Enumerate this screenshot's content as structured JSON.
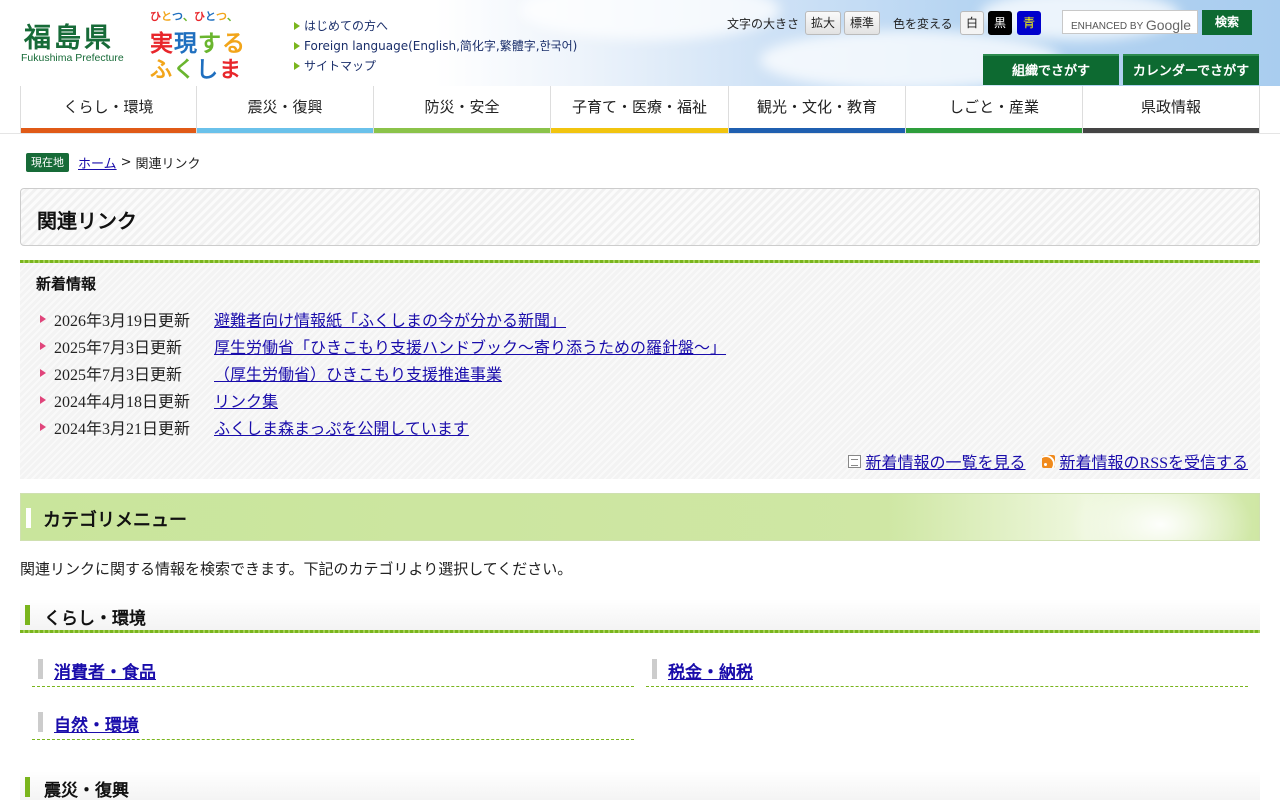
{
  "header": {
    "logo_title": "福島県",
    "logo_subtitle": "Fukushima Prefecture",
    "slogan_rows": [
      {
        "text": "ひとつ、ひとつ、",
        "colors": [
          "#e8262b",
          "#f2a51a",
          "#1f6fbf",
          "#6ab52e",
          "#e8262b",
          "#1f6fbf",
          "#f2a51a",
          "#6ab52e"
        ]
      },
      {
        "text": "実現する",
        "colors": [
          "#e8262b",
          "#1f6fbf",
          "#6ab52e",
          "#f2a51a"
        ]
      },
      {
        "text": "ふくしま",
        "colors": [
          "#f2a51a",
          "#6ab52e",
          "#1f6fbf",
          "#e8262b"
        ]
      }
    ],
    "quick_links": [
      "はじめての方へ",
      "Foreign language(English,简化字,繁體字,한국어)",
      "サイトマップ"
    ],
    "text_size_label": "文字の大きさ",
    "text_size_buttons": [
      "拡大",
      "標準"
    ],
    "color_label": "色を変える",
    "color_buttons": [
      {
        "label": "白",
        "bg": "#f4f4f4",
        "fg": "#222222"
      },
      {
        "label": "黒",
        "bg": "#000000",
        "fg": "#ffffff"
      },
      {
        "label": "青",
        "bg": "#0000cc",
        "fg": "#ffff00"
      }
    ],
    "search_enhanced_label": "ENHANCED BY",
    "search_google_label": "Google",
    "search_button": "検索",
    "find_buttons": [
      "組織でさがす",
      "カレンダーでさがす"
    ]
  },
  "nav": {
    "items": [
      {
        "label": "くらし・環境",
        "color": "#e05a17"
      },
      {
        "label": "震災・復興",
        "color": "#6ac1ea"
      },
      {
        "label": "防災・安全",
        "color": "#8bc34a"
      },
      {
        "label": "子育て・医療・福祉",
        "color": "#f1c40f"
      },
      {
        "label": "観光・文化・教育",
        "color": "#1f5fb0"
      },
      {
        "label": "しごと・産業",
        "color": "#2e9e3c"
      },
      {
        "label": "県政情報",
        "color": "#444444"
      }
    ]
  },
  "breadcrumb": {
    "tag": "現在地",
    "home": "ホーム",
    "separator": ">",
    "current": "関連リンク"
  },
  "page_title": "関連リンク",
  "news": {
    "heading": "新着情報",
    "items": [
      {
        "date": "2026年3月19日更新",
        "title": "避難者向け情報紙「ふくしまの今が分かる新聞」"
      },
      {
        "date": "2025年7月3日更新",
        "title": "厚生労働省「ひきこもり支援ハンドブック～寄り添うための羅針盤～」"
      },
      {
        "date": "2025年7月3日更新",
        "title": "（厚生労働省）ひきこもり支援推進事業"
      },
      {
        "date": "2024年4月18日更新",
        "title": "リンク集"
      },
      {
        "date": "2024年3月21日更新",
        "title": "ふくしま森まっぷを公開しています"
      }
    ],
    "list_link": "新着情報の一覧を見る",
    "rss_link": "新着情報のRSSを受信する"
  },
  "category": {
    "title": "カテゴリメニュー",
    "description": "関連リンクに関する情報を検索できます。下記のカテゴリより選択してください。",
    "sections": [
      {
        "label": "くらし・環境",
        "items": [
          "消費者・食品",
          "税金・納税",
          "自然・環境"
        ]
      },
      {
        "label": "震災・復興",
        "items": []
      }
    ]
  }
}
